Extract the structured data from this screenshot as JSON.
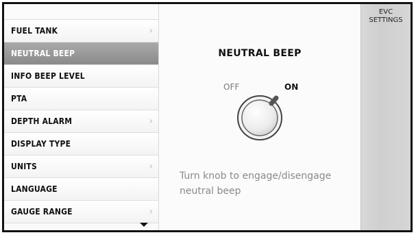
{
  "sidebar": {
    "items": [
      {
        "label": "FUEL TANK",
        "chevron": true,
        "selected": false
      },
      {
        "label": "NEUTRAL BEEP",
        "chevron": false,
        "selected": true
      },
      {
        "label": "INFO BEEP LEVEL",
        "chevron": false,
        "selected": false
      },
      {
        "label": "PTA",
        "chevron": false,
        "selected": false
      },
      {
        "label": "DEPTH ALARM",
        "chevron": true,
        "selected": false
      },
      {
        "label": "DISPLAY TYPE",
        "chevron": false,
        "selected": false
      },
      {
        "label": "UNITS",
        "chevron": true,
        "selected": false
      },
      {
        "label": "LANGUAGE",
        "chevron": false,
        "selected": false
      },
      {
        "label": "GAUGE RANGE",
        "chevron": true,
        "selected": false
      }
    ]
  },
  "main": {
    "title": "NEUTRAL BEEP",
    "knob": {
      "off_label": "OFF",
      "on_label": "ON",
      "state": "ON"
    },
    "instruction_line1": "Turn knob to engage/disengage",
    "instruction_line2": "neutral beep"
  },
  "right_panel": {
    "line1": "EVC",
    "line2": "SETTINGS"
  },
  "colors": {
    "selected_bg": "#999999",
    "indicator": "#555555"
  }
}
